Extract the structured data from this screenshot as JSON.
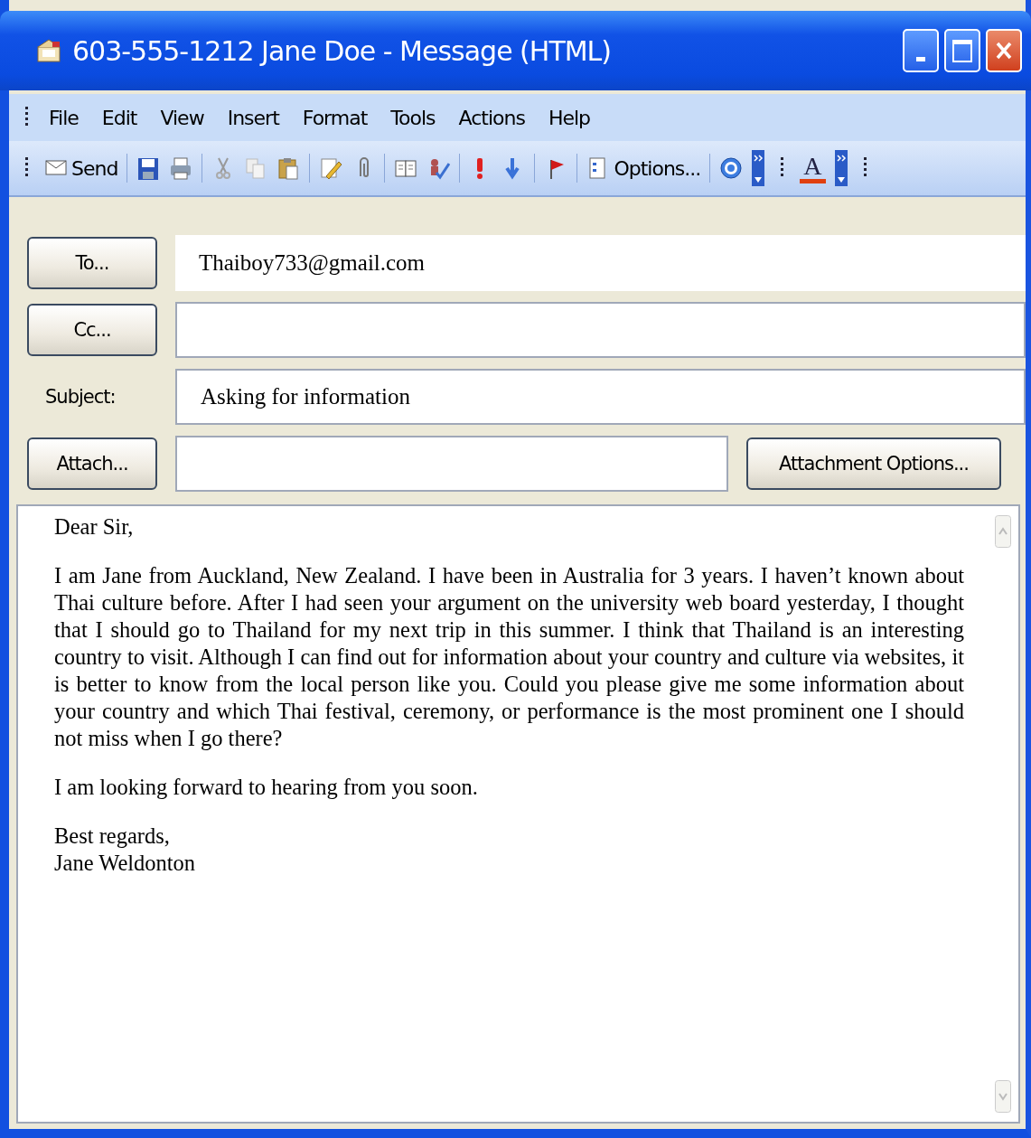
{
  "window": {
    "title": "603-555-1212 Jane Doe - Message (HTML)"
  },
  "menu": [
    "File",
    "Edit",
    "View",
    "Insert",
    "Format",
    "Tools",
    "Actions",
    "Help"
  ],
  "toolbar": [
    {
      "kind": "send",
      "label": "Send"
    },
    {
      "kind": "separator"
    },
    {
      "kind": "save"
    },
    {
      "kind": "print"
    },
    {
      "kind": "separator"
    },
    {
      "kind": "cut"
    },
    {
      "kind": "copy"
    },
    {
      "kind": "paste"
    },
    {
      "kind": "separator"
    },
    {
      "kind": "edit"
    },
    {
      "kind": "attach"
    },
    {
      "kind": "separator"
    },
    {
      "kind": "book"
    },
    {
      "kind": "check"
    },
    {
      "kind": "separator"
    },
    {
      "kind": "high"
    },
    {
      "kind": "low"
    },
    {
      "kind": "separator"
    },
    {
      "kind": "flag"
    },
    {
      "kind": "separator"
    },
    {
      "kind": "options",
      "label": "Options..."
    },
    {
      "kind": "separator"
    },
    {
      "kind": "help"
    },
    {
      "kind": "chevron"
    },
    {
      "kind": "fontcolor",
      "label": "A"
    },
    {
      "kind": "chevron"
    }
  ],
  "header": {
    "to": {
      "button": "To...",
      "value": "Thaiboy733@gmail.com"
    },
    "cc": {
      "button": "Cc..."
    },
    "subject": {
      "label": "Subject:",
      "value": "Asking for information"
    },
    "attach": {
      "button": "Attach...",
      "options_button": "Attachment Options..."
    }
  },
  "body": {
    "paragraphs": [
      [
        "Dear Sir,"
      ],
      [
        "I am Jane from Auckland, New Zealand. I have been in Australia for 3 years.  I haven’t known about Thai culture before. After I had seen your argument on the university web board yesterday, I thought that I should go to Thailand for my next trip in this summer. I think that Thailand is an interesting country to visit. Although I can find out for information about your country and culture via websites, it is better to know from the local person like you. Could you please give me some information about your country and which Thai festival, ceremony, or performance is the most prominent one I should not miss when I go there?"
      ],
      [
        "I am looking forward to hearing from you soon."
      ],
      [
        "Best regards,",
        "Jane Weldonton"
      ]
    ]
  }
}
